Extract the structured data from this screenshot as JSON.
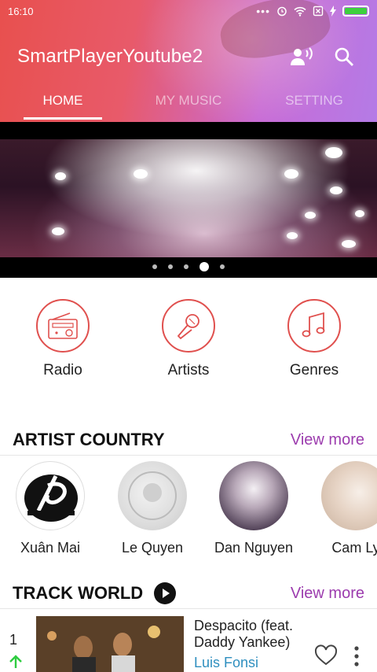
{
  "status_bar": {
    "time": "16:10",
    "icons": [
      "dots-icon",
      "alarm-icon",
      "wifi-icon",
      "sim-off-icon",
      "charging-icon",
      "battery-icon"
    ],
    "battery_color": "#3dd13d"
  },
  "app_bar": {
    "title": "SmartPlayerYoutube2",
    "actions": [
      "voice-search-icon",
      "search-icon"
    ]
  },
  "tabs": [
    {
      "label": "HOME",
      "active": true
    },
    {
      "label": "MY MUSIC",
      "active": false
    },
    {
      "label": "SETTING",
      "active": false
    }
  ],
  "banner": {
    "slide_count": 5,
    "active_slide": 4
  },
  "categories": [
    {
      "label": "Radio",
      "icon": "radio-icon"
    },
    {
      "label": "Artists",
      "icon": "microphone-icon"
    },
    {
      "label": "Genres",
      "icon": "music-note-icon"
    }
  ],
  "artist_country": {
    "title": "ARTIST COUNTRY",
    "view_more": "View more",
    "artists": [
      {
        "name": "Xuân Mai"
      },
      {
        "name": "Le Quyen"
      },
      {
        "name": "Dan Nguyen"
      },
      {
        "name": "Cam Ly"
      }
    ]
  },
  "track_world": {
    "title": "TRACK WORLD",
    "view_more": "View more",
    "tracks": [
      {
        "rank": "1",
        "title": "Despacito (feat. Daddy Yankee)",
        "artist": "Luis Fonsi",
        "trend": "up"
      }
    ]
  },
  "colors": {
    "accent": "#e0504e",
    "view_more": "#9c3cae",
    "artist_link": "#2f8fbf",
    "trend_up": "#2ecc40"
  }
}
